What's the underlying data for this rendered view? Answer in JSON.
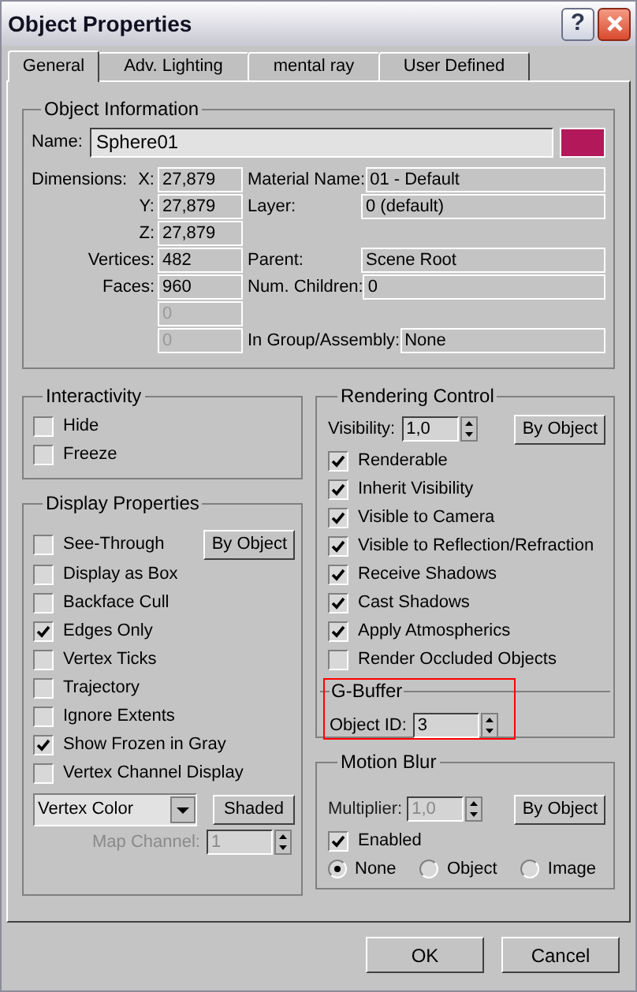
{
  "window": {
    "title": "Object Properties",
    "help_label": "?"
  },
  "tabs": [
    {
      "label": "General",
      "selected": true
    },
    {
      "label": "Adv. Lighting",
      "selected": false
    },
    {
      "label": "mental ray",
      "selected": false
    },
    {
      "label": "User Defined",
      "selected": false
    }
  ],
  "object_information": {
    "title": "Object Information",
    "name_label": "Name:",
    "name_value": "Sphere01",
    "color": "#b3185a",
    "rows": [
      {
        "label": "Dimensions:",
        "axis": "X:",
        "value": "27,879",
        "disabled": false,
        "info_label": "Material Name:",
        "info_value": "01 - Default"
      },
      {
        "axis": "Y:",
        "value": "27,879",
        "disabled": false,
        "info_label": "Layer:",
        "info_value": "0 (default)"
      },
      {
        "axis": "Z:",
        "value": "27,879",
        "disabled": false
      },
      {
        "label": "Vertices:",
        "value": "482",
        "disabled": false,
        "info_label": "Parent:",
        "info_value": "Scene Root"
      },
      {
        "label": "Faces:",
        "value": "960",
        "disabled": false,
        "info_label": "Num. Children:",
        "info_value": "0"
      },
      {
        "value": "0",
        "disabled": true
      },
      {
        "value": "0",
        "disabled": true,
        "info_label": "In Group/Assembly:",
        "info_value": "None"
      }
    ]
  },
  "interactivity": {
    "title": "Interactivity",
    "options": [
      {
        "label": "Hide",
        "checked": false
      },
      {
        "label": "Freeze",
        "checked": false
      }
    ]
  },
  "display_properties": {
    "title": "Display Properties",
    "by_object_button": "By Object",
    "options": [
      {
        "label": "See-Through",
        "checked": false
      },
      {
        "label": "Display as Box",
        "checked": false
      },
      {
        "label": "Backface Cull",
        "checked": false
      },
      {
        "label": "Edges Only",
        "checked": true
      },
      {
        "label": "Vertex Ticks",
        "checked": false
      },
      {
        "label": "Trajectory",
        "checked": false
      },
      {
        "label": "Ignore Extents",
        "checked": false
      },
      {
        "label": "Show Frozen in Gray",
        "checked": true
      },
      {
        "label": "Vertex Channel Display",
        "checked": false
      }
    ],
    "color_mode": "Vertex Color",
    "shaded_button": "Shaded",
    "map_channel_label": "Map Channel:",
    "map_channel_value": "1",
    "map_channel_disabled": true
  },
  "rendering_control": {
    "title": "Rendering Control",
    "visibility_label": "Visibility:",
    "visibility_value": "1,0",
    "by_object_button": "By Object",
    "options": [
      {
        "label": "Renderable",
        "checked": true
      },
      {
        "label": "Inherit Visibility",
        "checked": true
      },
      {
        "label": "Visible to Camera",
        "checked": true
      },
      {
        "label": "Visible to Reflection/Refraction",
        "checked": true
      },
      {
        "label": "Receive Shadows",
        "checked": true
      },
      {
        "label": "Cast Shadows",
        "checked": true
      },
      {
        "label": "Apply Atmospherics",
        "checked": true
      },
      {
        "label": "Render Occluded Objects",
        "checked": false
      }
    ]
  },
  "g_buffer": {
    "title": "G-Buffer",
    "object_id_label": "Object ID:",
    "object_id_value": "3",
    "highlighted": true
  },
  "motion_blur": {
    "title": "Motion Blur",
    "multiplier_label": "Multiplier:",
    "multiplier_value": "1,0",
    "multiplier_disabled": true,
    "by_object_button": "By Object",
    "enabled": {
      "label": "Enabled",
      "checked": true
    },
    "types": [
      {
        "label": "None",
        "selected": true
      },
      {
        "label": "Object",
        "selected": false
      },
      {
        "label": "Image",
        "selected": false
      }
    ]
  },
  "buttons": [
    {
      "label": "OK"
    },
    {
      "label": "Cancel"
    }
  ]
}
